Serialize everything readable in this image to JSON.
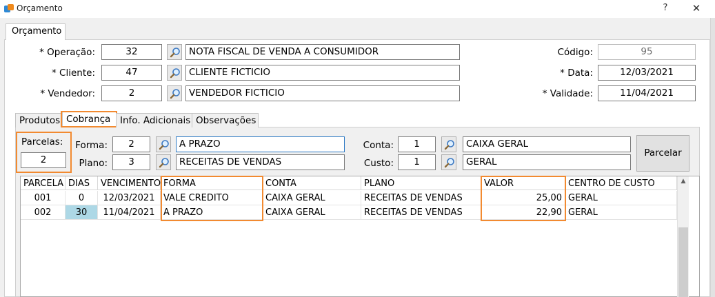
{
  "window": {
    "title": "Orçamento",
    "help": "?",
    "close": "✕"
  },
  "top_tab": "Orçamento",
  "header": {
    "operacao": {
      "label": "* Operação:",
      "code": "32",
      "desc": "NOTA FISCAL DE VENDA A CONSUMIDOR"
    },
    "cliente": {
      "label": "* Cliente:",
      "code": "47",
      "desc": "CLIENTE FICTICIO"
    },
    "vendedor": {
      "label": "* Vendedor:",
      "code": "2",
      "desc": "VENDEDOR FICTICIO"
    },
    "codigo": {
      "label": "Código:",
      "value": "95"
    },
    "data": {
      "label": "* Data:",
      "value": "12/03/2021"
    },
    "validade": {
      "label": "* Validade:",
      "value": "11/04/2021"
    }
  },
  "tabs": [
    "Produtos",
    "Cobrança",
    "Info. Adicionais",
    "Observações"
  ],
  "cobranca": {
    "parcelas": {
      "label": "Parcelas:",
      "value": "2"
    },
    "forma": {
      "label": "Forma:",
      "code": "2",
      "desc": "A PRAZO"
    },
    "plano": {
      "label": "Plano:",
      "code": "3",
      "desc": "RECEITAS DE VENDAS"
    },
    "conta": {
      "label": "Conta:",
      "code": "1",
      "desc": "CAIXA GERAL"
    },
    "custo": {
      "label": "Custo:",
      "code": "1",
      "desc": "GERAL"
    },
    "parcelar_button": "Parcelar"
  },
  "grid": {
    "columns": [
      "PARCELA",
      "DIAS",
      "VENCIMENTO",
      "FORMA",
      "CONTA",
      "PLANO",
      "VALOR",
      "CENTRO DE CUSTO"
    ],
    "rows": [
      [
        "001",
        "0",
        "12/03/2021",
        "VALE CREDITO",
        "CAIXA GERAL",
        "RECEITAS DE VENDAS",
        "25,00",
        "GERAL"
      ],
      [
        "002",
        "30",
        "11/04/2021",
        "A PRAZO",
        "CAIXA GERAL",
        "RECEITAS DE VENDAS",
        "22,90",
        "GERAL"
      ]
    ]
  },
  "colors": {
    "highlight": "#f28a30",
    "selected_cell": "#add8e6"
  },
  "icons": {
    "lookup": "magnifier-icon",
    "scroll_up": "chevron-up-icon"
  }
}
